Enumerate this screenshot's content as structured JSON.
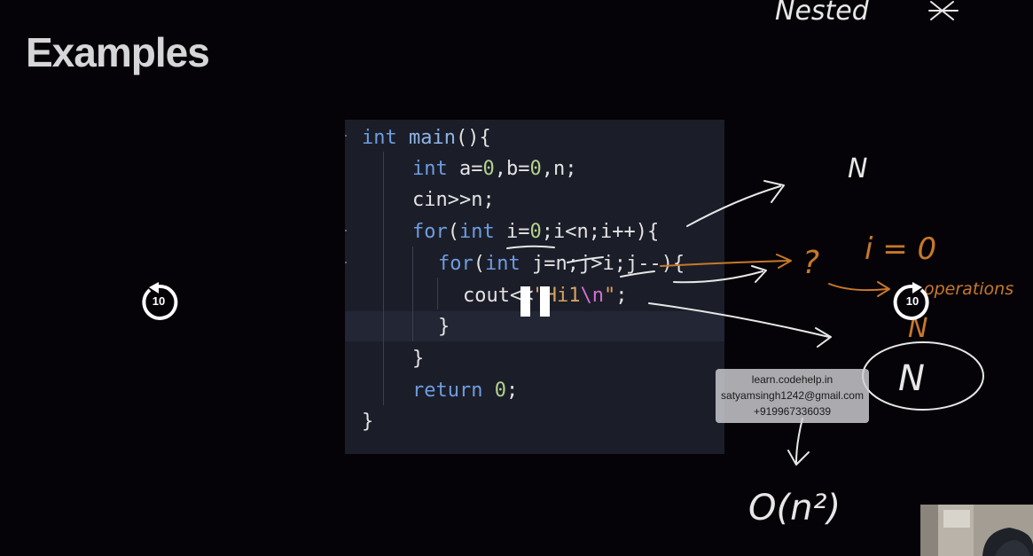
{
  "slide": {
    "title": "Examples"
  },
  "code": {
    "lines": [
      "int main(){",
      "int a=0,b=0,n;",
      "cin>>n;",
      "for(int i=0;i<n;i++){",
      "for(int j=n;j>i;j--){",
      "cout<<\"Hi1\\n\";",
      "}",
      "}",
      "return 0;",
      "}"
    ]
  },
  "player": {
    "rewind_label": "10",
    "forward_label": "10",
    "rewind_icon": "replay-10-icon",
    "forward_icon": "forward-10-icon",
    "pause_icon": "pause-icon"
  },
  "watermark": {
    "site": "learn.codehelp.in",
    "email": "satyamsingh1242@gmail.com",
    "phone": "+919967336039"
  },
  "annotations": {
    "nested": "Nested",
    "n_first": "N",
    "question": "?",
    "i_zero": "i = 0",
    "operations": "operations",
    "n_mid": "N",
    "n_circled": "N",
    "big_o": "O(n²)"
  },
  "colors": {
    "background": "#050307",
    "code_background": "#1b1e29",
    "keyword": "#6f9ce0",
    "number": "#b5d08e",
    "string": "#d9a15e",
    "ink_white": "#e7e7e7",
    "ink_orange": "#c7782a"
  }
}
